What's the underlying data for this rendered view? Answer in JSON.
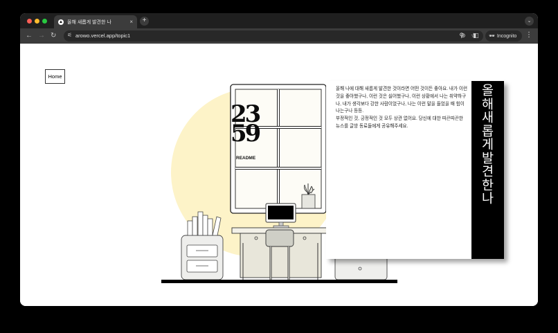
{
  "browser": {
    "tab_title": "올해 새롭게 발견한 나",
    "tab_close": "×",
    "new_tab": "+",
    "url": "arowo.vercel.app/topic1",
    "incognito_label": "Incognito",
    "icons": [
      "back-icon",
      "forward-icon",
      "reload-icon",
      "site-settings-icon",
      "zoom-icon",
      "bookmark-star-icon",
      "extensions-icon",
      "side-panel-icon",
      "incognito-icon",
      "menu-icon"
    ]
  },
  "page": {
    "home_label": "Home",
    "clock": {
      "hours": "23",
      "minutes": "59"
    },
    "readme_label": "README",
    "card": {
      "paragraphs": [
        "올해 나에 대해 새롭게 발견한 것이라면 어떤 것이든 좋아요. 내가 이런 것을 좋아했구나, 이런 것은 싫어했구나, 이런 상황에서 나는 취약하구나, 내가 생각보다 강한 사람이었구나, 나는 이런 말을 들었을 때 힘이 나는구나 등등.",
        "부정적인 것, 긍정적인 것 모두 상관 없어요. 당신에 대한 따끈따끈한 뉴스를 글방 동료들에게 공유해주세요."
      ],
      "title": "올해 새롭게 발견한 나"
    }
  },
  "colors": {
    "accent_circle": "#fdf3c8",
    "card_title_bg": "#000000"
  }
}
